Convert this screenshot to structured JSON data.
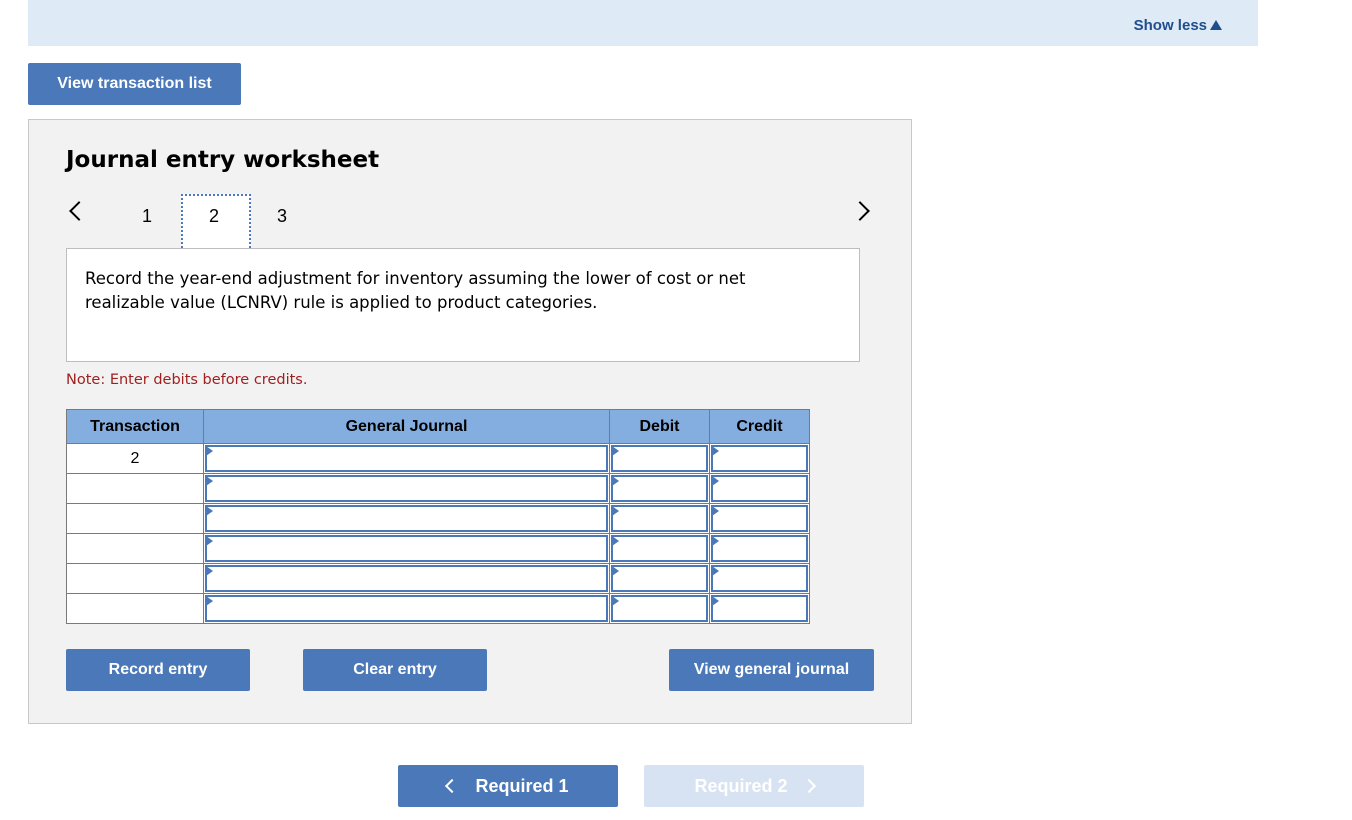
{
  "topbar": {
    "show_less_label": "Show less"
  },
  "view_transaction_list_label": "View transaction list",
  "worksheet": {
    "title": "Journal entry worksheet",
    "pages": [
      "1",
      "2",
      "3"
    ],
    "selected_page": "2",
    "description": "Record the year-end adjustment for inventory assuming the lower of cost or net realizable value (LCNRV) rule is applied to product categories.",
    "note": "Note: Enter debits before credits.",
    "table": {
      "headers": [
        "Transaction",
        "General Journal",
        "Debit",
        "Credit"
      ],
      "rows": [
        {
          "transaction": "2",
          "account": "",
          "debit": "",
          "credit": ""
        },
        {
          "transaction": "",
          "account": "",
          "debit": "",
          "credit": ""
        },
        {
          "transaction": "",
          "account": "",
          "debit": "",
          "credit": ""
        },
        {
          "transaction": "",
          "account": "",
          "debit": "",
          "credit": ""
        },
        {
          "transaction": "",
          "account": "",
          "debit": "",
          "credit": ""
        },
        {
          "transaction": "",
          "account": "",
          "debit": "",
          "credit": ""
        }
      ]
    },
    "buttons": {
      "record": "Record entry",
      "clear": "Clear entry",
      "view_journal": "View general journal"
    }
  },
  "footer": {
    "prev_label": "Required 1",
    "next_label": "Required 2"
  },
  "colors": {
    "primary_button": "#4a78b8",
    "header_bar": "#dfeaf7",
    "table_header": "#84aee0",
    "note_text": "#a02020",
    "disabled_button": "#d7e3f2"
  }
}
